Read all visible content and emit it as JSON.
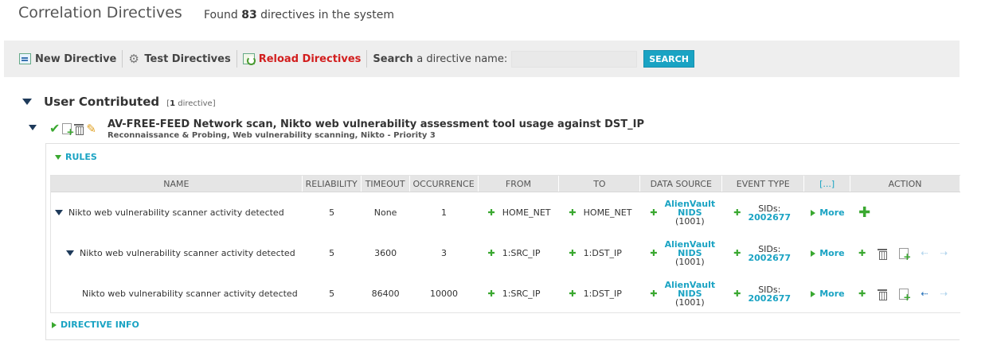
{
  "header": {
    "title": "Correlation Directives",
    "found_prefix": "Found",
    "found_count": "83",
    "found_suffix": "directives in the system"
  },
  "toolbar": {
    "new_directive": "New Directive",
    "test_directives": "Test Directives",
    "reload_directives": "Reload Directives",
    "search_label_bold": "Search",
    "search_label_rest": "a directive name:",
    "search_value": "",
    "search_button": "SEARCH"
  },
  "group": {
    "title": "User Contributed",
    "count_open": "[",
    "count_num": "1",
    "count_text": "directive]"
  },
  "directive": {
    "title": "AV-FREE-FEED Network scan, Nikto web vulnerability assessment tool usage against DST_IP",
    "subtitle": "Reconnaissance & Probing, Web vulnerability scanning, Nikto - Priority 3"
  },
  "sections": {
    "rules": "RULES",
    "directive_info": "DIRECTIVE INFO"
  },
  "table": {
    "headers": {
      "name": "NAME",
      "reliability": "RELIABILITY",
      "timeout": "TIMEOUT",
      "occurrence": "OCCURRENCE",
      "from": "FROM",
      "to": "TO",
      "data_source": "DATA SOURCE",
      "event_type": "EVENT TYPE",
      "more": "[...]",
      "action": "ACTION"
    },
    "rows": [
      {
        "name": "Nikto web vulnerability scanner activity detected",
        "reliability": "5",
        "timeout": "None",
        "occurrence": "1",
        "from": "HOME_NET",
        "to": "HOME_NET",
        "ds_line1": "AlienVault",
        "ds_line2": "NIDS",
        "ds_id": "(1001)",
        "sid_label": "SIDs:",
        "sid_value": "2002677",
        "more": "More"
      },
      {
        "name": "Nikto web vulnerability scanner activity detected",
        "reliability": "5",
        "timeout": "3600",
        "occurrence": "3",
        "from": "1:SRC_IP",
        "to": "1:DST_IP",
        "ds_line1": "AlienVault",
        "ds_line2": "NIDS",
        "ds_id": "(1001)",
        "sid_label": "SIDs:",
        "sid_value": "2002677",
        "more": "More"
      },
      {
        "name": "Nikto web vulnerability scanner activity detected",
        "reliability": "5",
        "timeout": "86400",
        "occurrence": "10000",
        "from": "1:SRC_IP",
        "to": "1:DST_IP",
        "ds_line1": "AlienVault",
        "ds_line2": "NIDS",
        "ds_id": "(1001)",
        "sid_label": "SIDs:",
        "sid_value": "2002677",
        "more": "More"
      }
    ]
  },
  "colors": {
    "accent": "#1aa3c3",
    "add_green": "#3aa830",
    "reload_red": "#d21e1e"
  }
}
